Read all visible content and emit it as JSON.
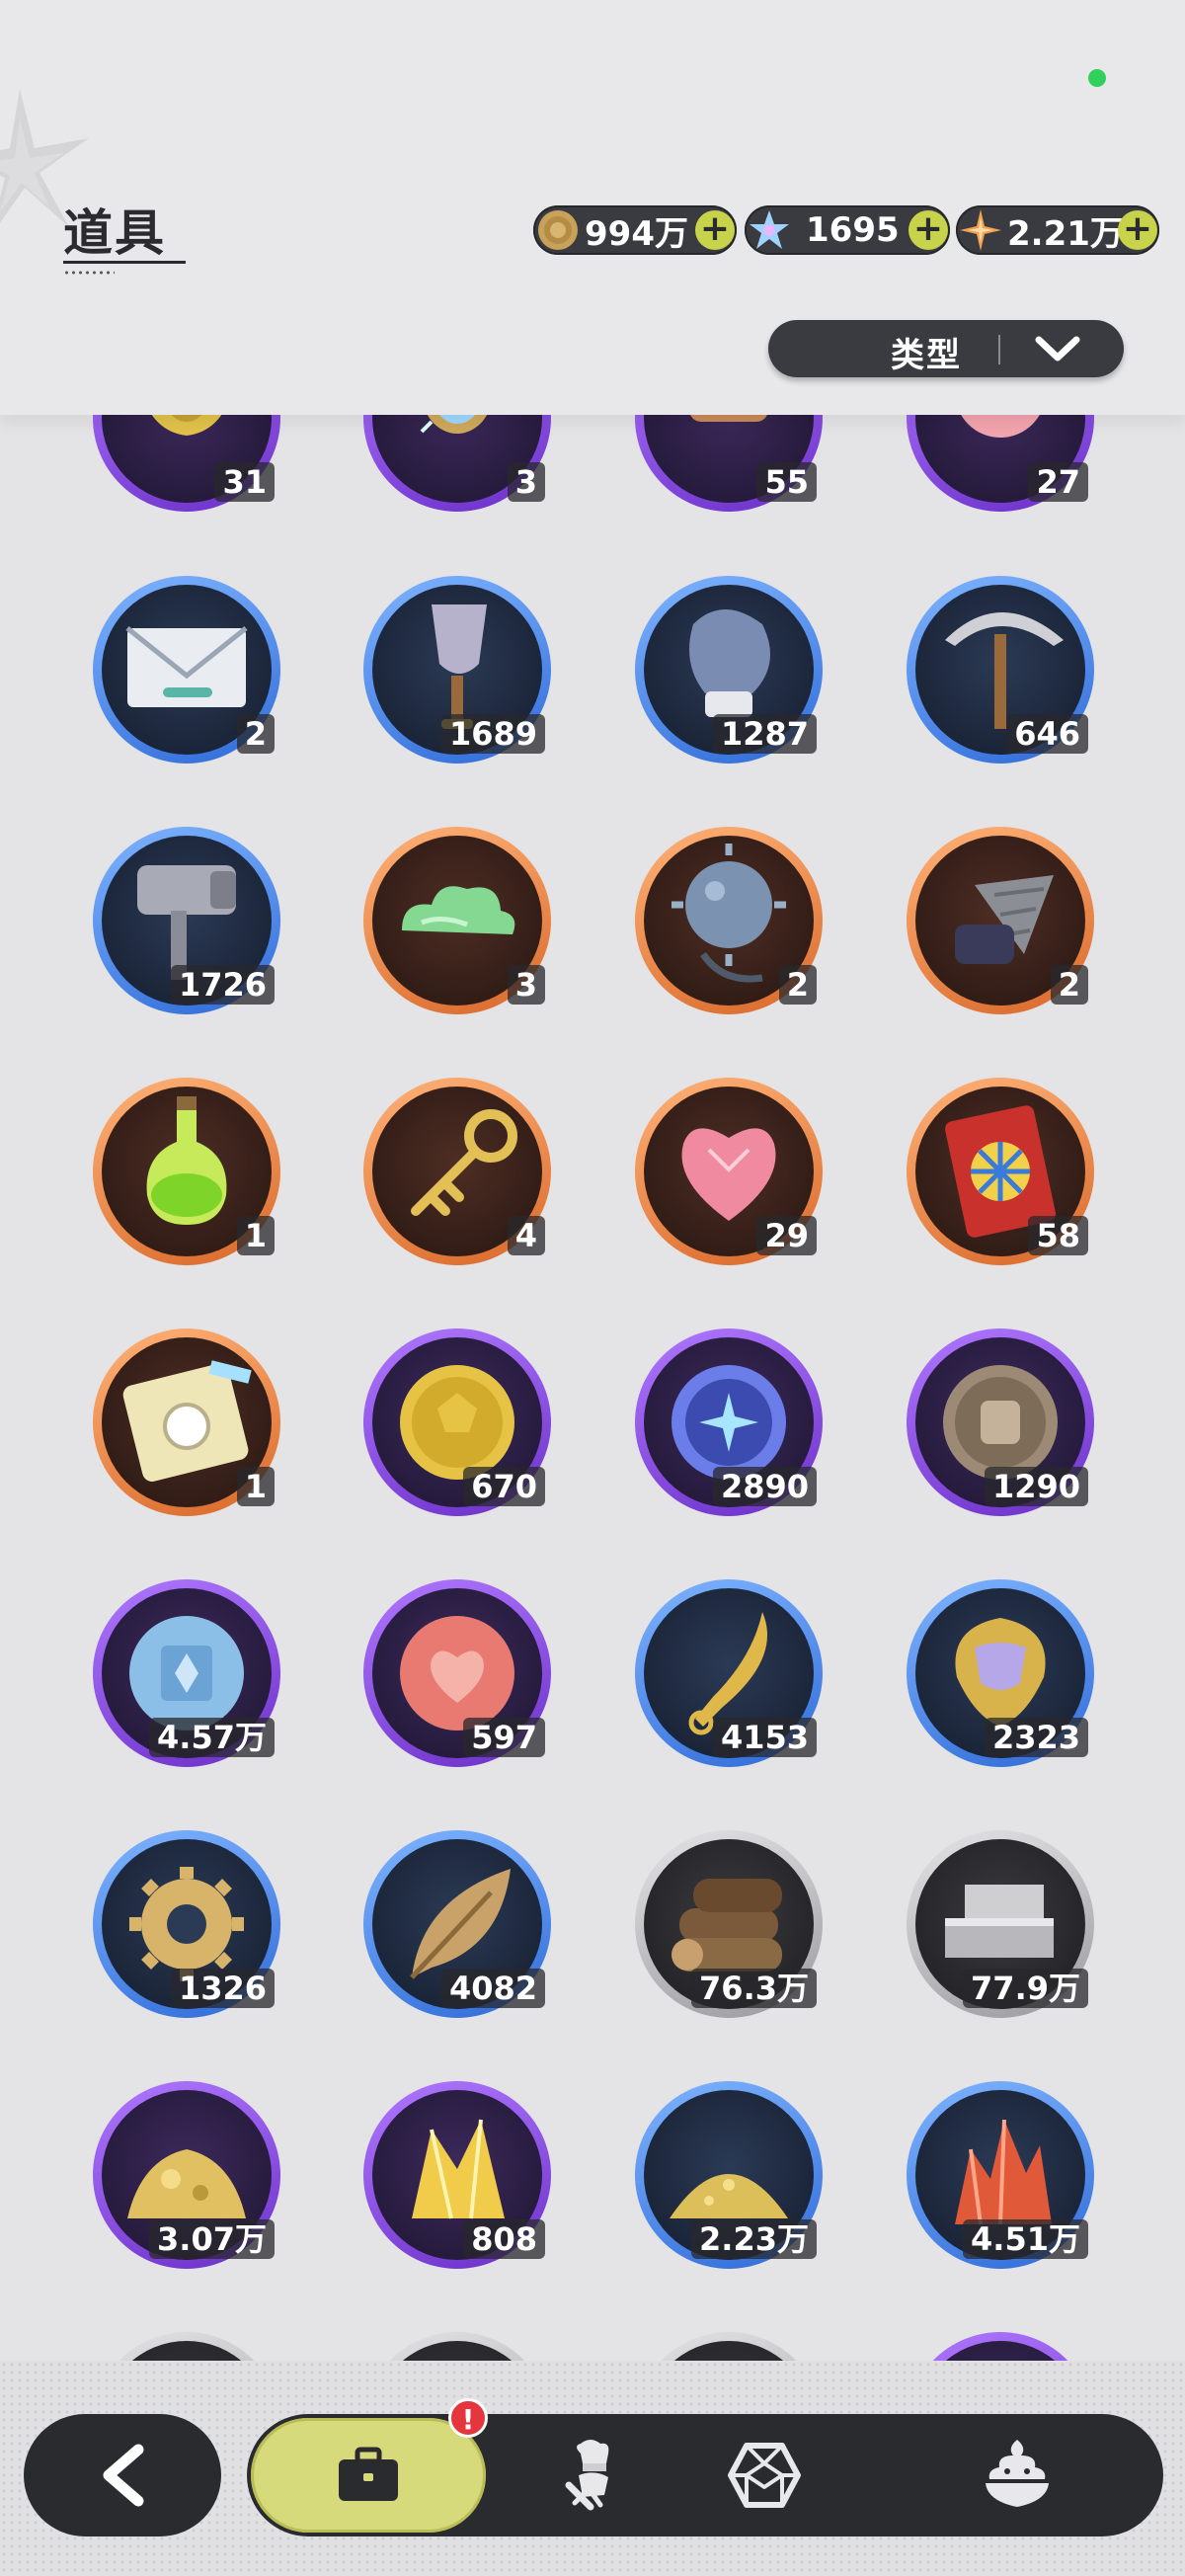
{
  "header": {
    "title": "道具",
    "currencies": [
      {
        "name": "gold-coin",
        "value": "994万"
      },
      {
        "name": "crystal",
        "value": "1695"
      },
      {
        "name": "star-shard",
        "value": "2.21万"
      }
    ],
    "filter": {
      "label": "类型"
    }
  },
  "items": [
    {
      "ring": "purple",
      "icon": "gold-shell-icon",
      "count": "31"
    },
    {
      "ring": "purple",
      "icon": "mirror-icon",
      "count": "3"
    },
    {
      "ring": "purple",
      "icon": "scroll-icon",
      "count": "55"
    },
    {
      "ring": "purple",
      "icon": "pink-orb-icon",
      "count": "27"
    },
    {
      "ring": "blue",
      "icon": "envelope-icon",
      "count": "2"
    },
    {
      "ring": "blue",
      "icon": "shovel-icon",
      "count": "1689"
    },
    {
      "ring": "blue",
      "icon": "boxing-glove-icon",
      "count": "1287"
    },
    {
      "ring": "blue",
      "icon": "pickaxe-icon",
      "count": "646"
    },
    {
      "ring": "blue",
      "icon": "hammer-icon",
      "count": "1726"
    },
    {
      "ring": "orange",
      "icon": "green-cloud-icon",
      "count": "3"
    },
    {
      "ring": "orange",
      "icon": "spiked-ball-icon",
      "count": "2"
    },
    {
      "ring": "orange",
      "icon": "drill-icon",
      "count": "2"
    },
    {
      "ring": "orange",
      "icon": "potion-icon",
      "count": "1"
    },
    {
      "ring": "orange",
      "icon": "key-icon",
      "count": "4"
    },
    {
      "ring": "orange",
      "icon": "heart-gem-icon",
      "count": "29"
    },
    {
      "ring": "orange",
      "icon": "wheel-ticket-icon",
      "count": "58"
    },
    {
      "ring": "orange",
      "icon": "rainbow-ticket-icon",
      "count": "1"
    },
    {
      "ring": "purple",
      "icon": "soccer-coin-icon",
      "count": "670"
    },
    {
      "ring": "purple",
      "icon": "star-coin-icon",
      "count": "2890"
    },
    {
      "ring": "purple",
      "icon": "fist-coin-icon",
      "count": "1290"
    },
    {
      "ring": "purple",
      "icon": "blue-emblem-icon",
      "count": "4.57万"
    },
    {
      "ring": "purple",
      "icon": "heart-coin-icon",
      "count": "597"
    },
    {
      "ring": "blue",
      "icon": "golden-blade-icon",
      "count": "4153"
    },
    {
      "ring": "blue",
      "icon": "scale-pendant-icon",
      "count": "2323"
    },
    {
      "ring": "blue",
      "icon": "gear-icon",
      "count": "1326"
    },
    {
      "ring": "blue",
      "icon": "leaf-icon",
      "count": "4082"
    },
    {
      "ring": "grey",
      "icon": "logs-icon",
      "count": "76.3万"
    },
    {
      "ring": "grey",
      "icon": "stone-bricks-icon",
      "count": "77.9万"
    },
    {
      "ring": "purple",
      "icon": "gold-ore-icon",
      "count": "3.07万"
    },
    {
      "ring": "purple",
      "icon": "gold-crystal-icon",
      "count": "808"
    },
    {
      "ring": "blue",
      "icon": "gold-sand-icon",
      "count": "2.23万"
    },
    {
      "ring": "blue",
      "icon": "red-crystal-icon",
      "count": "4.51万"
    },
    {
      "ring": "grey",
      "icon": "partial-item-icon",
      "count": ""
    },
    {
      "ring": "grey",
      "icon": "partial-item-icon",
      "count": ""
    },
    {
      "ring": "grey",
      "icon": "partial-item-icon",
      "count": ""
    },
    {
      "ring": "purple",
      "icon": "partial-item-icon",
      "count": ""
    }
  ],
  "nav": {
    "back_icon": "back-arrow-icon",
    "tabs": [
      {
        "icon": "briefcase-icon",
        "active": true,
        "badge": "!"
      },
      {
        "icon": "chef-icon",
        "active": false
      },
      {
        "icon": "gem-outline-icon",
        "active": false
      },
      {
        "icon": "dessert-icon",
        "active": false
      }
    ]
  },
  "colors": {
    "accent": "#d6da7a",
    "ring_purple": "#8a4be8",
    "ring_blue": "#4a8cf0",
    "ring_orange": "#f08a45",
    "ring_grey": "#bdbdc1",
    "badge_red": "#e5353d"
  }
}
